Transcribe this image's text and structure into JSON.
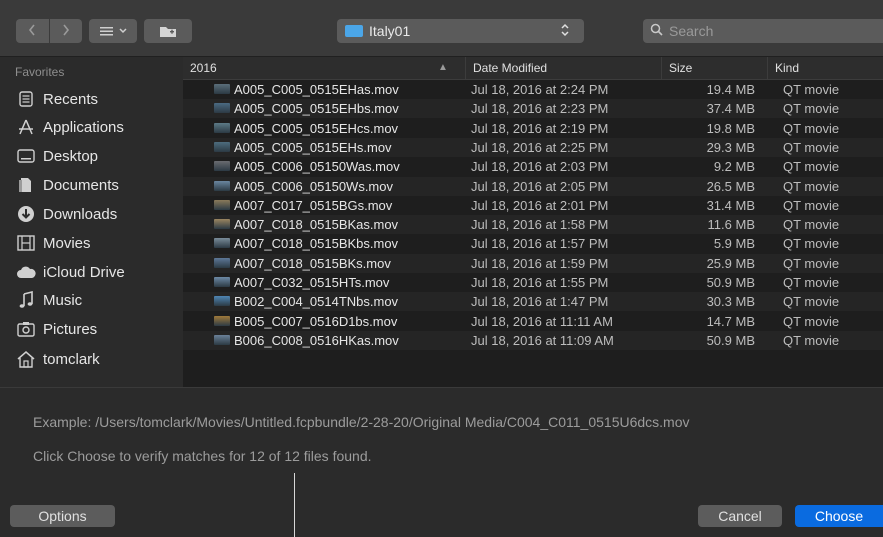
{
  "toolbar": {
    "back_icon": "chevron-left-icon",
    "forward_icon": "chevron-right-icon",
    "view_icon": "list-view-icon",
    "new_folder_icon": "new-folder-icon",
    "location": "Italy01",
    "search_placeholder": "Search"
  },
  "sidebar": {
    "heading": "Favorites",
    "items": [
      {
        "label": "Recents",
        "icon": "recents-icon"
      },
      {
        "label": "Applications",
        "icon": "applications-icon"
      },
      {
        "label": "Desktop",
        "icon": "desktop-icon"
      },
      {
        "label": "Documents",
        "icon": "documents-icon"
      },
      {
        "label": "Downloads",
        "icon": "downloads-icon"
      },
      {
        "label": "Movies",
        "icon": "movies-icon"
      },
      {
        "label": "iCloud Drive",
        "icon": "icloud-icon"
      },
      {
        "label": "Music",
        "icon": "music-icon"
      },
      {
        "label": "Pictures",
        "icon": "pictures-icon"
      },
      {
        "label": "tomclark",
        "icon": "home-icon"
      }
    ]
  },
  "list": {
    "columns": {
      "name": "2016",
      "date": "Date Modified",
      "size": "Size",
      "kind": "Kind"
    },
    "files": [
      {
        "name": "A005_C005_0515EHas.mov",
        "date": "Jul 18, 2016 at 2:24 PM",
        "size": "19.4 MB",
        "kind": "QT movie"
      },
      {
        "name": "A005_C005_0515EHbs.mov",
        "date": "Jul 18, 2016 at 2:23 PM",
        "size": "37.4 MB",
        "kind": "QT movie"
      },
      {
        "name": "A005_C005_0515EHcs.mov",
        "date": "Jul 18, 2016 at 2:19 PM",
        "size": "19.8 MB",
        "kind": "QT movie"
      },
      {
        "name": "A005_C005_0515EHs.mov",
        "date": "Jul 18, 2016 at 2:25 PM",
        "size": "29.3 MB",
        "kind": "QT movie"
      },
      {
        "name": "A005_C006_05150Was.mov",
        "date": "Jul 18, 2016 at 2:03 PM",
        "size": "9.2 MB",
        "kind": "QT movie"
      },
      {
        "name": "A005_C006_05150Ws.mov",
        "date": "Jul 18, 2016 at 2:05 PM",
        "size": "26.5 MB",
        "kind": "QT movie"
      },
      {
        "name": "A007_C017_0515BGs.mov",
        "date": "Jul 18, 2016 at 2:01 PM",
        "size": "31.4 MB",
        "kind": "QT movie"
      },
      {
        "name": "A007_C018_0515BKas.mov",
        "date": "Jul 18, 2016 at 1:58 PM",
        "size": "11.6 MB",
        "kind": "QT movie"
      },
      {
        "name": "A007_C018_0515BKbs.mov",
        "date": "Jul 18, 2016 at 1:57 PM",
        "size": "5.9 MB",
        "kind": "QT movie"
      },
      {
        "name": "A007_C018_0515BKs.mov",
        "date": "Jul 18, 2016 at 1:59 PM",
        "size": "25.9 MB",
        "kind": "QT movie"
      },
      {
        "name": "A007_C032_0515HTs.mov",
        "date": "Jul 18, 2016 at 1:55 PM",
        "size": "50.9 MB",
        "kind": "QT movie"
      },
      {
        "name": "B002_C004_0514TNbs.mov",
        "date": "Jul 18, 2016 at 1:47 PM",
        "size": "30.3 MB",
        "kind": "QT movie"
      },
      {
        "name": "B005_C007_0516D1bs.mov",
        "date": "Jul 18, 2016 at 11:11 AM",
        "size": "14.7 MB",
        "kind": "QT movie"
      },
      {
        "name": "B006_C008_0516HKas.mov",
        "date": "Jul 18, 2016 at 11:09 AM",
        "size": "50.9 MB",
        "kind": "QT movie"
      }
    ]
  },
  "info": {
    "example": "Example: /Users/tomclark/Movies/Untitled.fcpbundle/2-28-20/Original Media/C004_C011_0515U6dcs.mov",
    "verify": "Click Choose to verify matches for 12 of 12 files found."
  },
  "buttons": {
    "options": "Options",
    "cancel": "Cancel",
    "choose": "Choose"
  },
  "colors": {
    "accent": "#0a6be0",
    "folder": "#4ba6e8"
  }
}
